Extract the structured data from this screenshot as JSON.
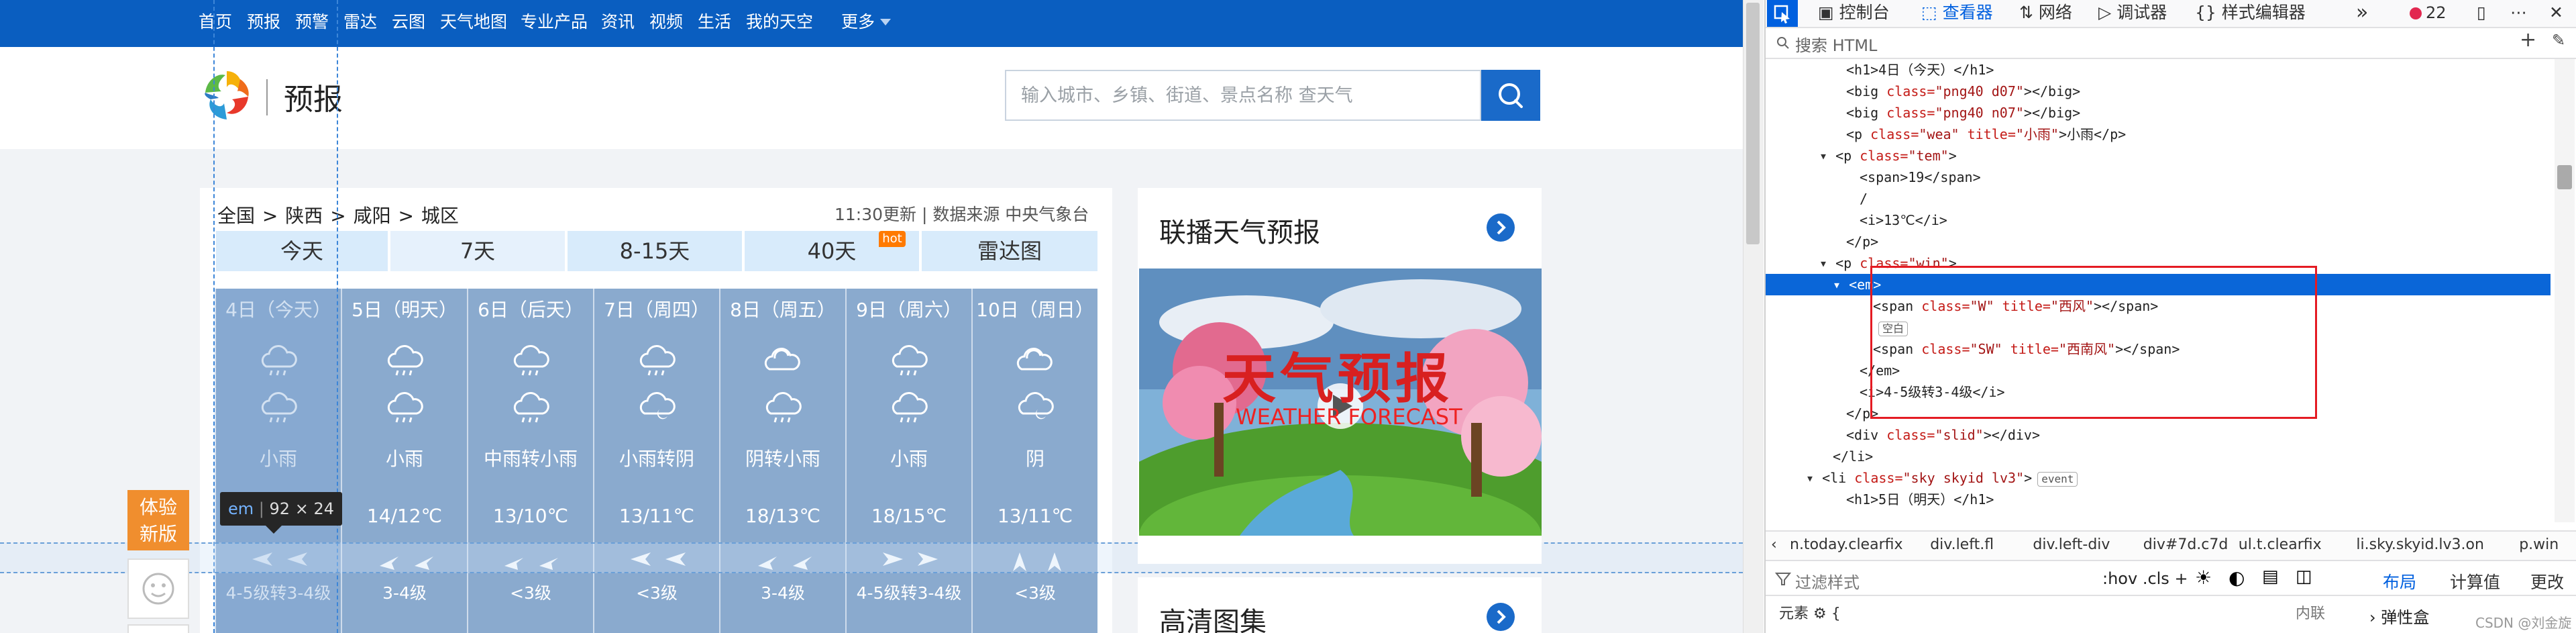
{
  "nav": [
    "首页",
    "预报",
    "预警",
    "雷达",
    "云图",
    "天气地图",
    "专业产品",
    "资讯",
    "视频",
    "生活",
    "我的天空",
    "更多"
  ],
  "header": {
    "logo_text": "预报",
    "search_placeholder": "输入城市、乡镇、街道、景点名称 查天气"
  },
  "breadcrumb": [
    "全国",
    "陕西",
    "咸阳",
    "城区"
  ],
  "update_info": "11:30更新 | 数据来源 中央气象台",
  "tabs": [
    "今天",
    "7天",
    "8-15天",
    "40天",
    "雷达图"
  ],
  "hot_badge": "hot",
  "days": [
    {
      "name": "4日（今天）",
      "weather": "小雨",
      "temp": "",
      "wind": "4-5级转3-4级"
    },
    {
      "name": "5日（明天）",
      "weather": "小雨",
      "temp": "14/12℃",
      "wind": "3-4级"
    },
    {
      "name": "6日（后天）",
      "weather": "中雨转小雨",
      "temp": "13/10℃",
      "wind": "<3级"
    },
    {
      "name": "7日（周四）",
      "weather": "小雨转阴",
      "temp": "13/11℃",
      "wind": "<3级"
    },
    {
      "name": "8日（周五）",
      "weather": "阴转小雨",
      "temp": "18/13℃",
      "wind": "3-4级"
    },
    {
      "name": "9日（周六）",
      "weather": "小雨",
      "temp": "18/15℃",
      "wind": "4-5级转3-4级"
    },
    {
      "name": "10日（周日）",
      "weather": "阴",
      "temp": "13/11℃",
      "wind": "<3级"
    }
  ],
  "tooltip": {
    "tag": "em",
    "dims": "92 × 24"
  },
  "side": {
    "tiyan": "体验\n新版",
    "tiyan_l1": "体验",
    "tiyan_l2": "新版"
  },
  "lianbo": {
    "title": "联播天气预报",
    "video_title": "天气预报",
    "video_sub": "WEATHER FORECAST"
  },
  "gaoqing": {
    "title": "高清图集"
  },
  "devtools": {
    "tabs": [
      "控制台",
      "查看器",
      "网络",
      "调试器",
      "样式编辑器"
    ],
    "active_tab": "查看器",
    "error_count": "22",
    "search_label": "搜索 HTML",
    "tree": [
      {
        "indent": 6,
        "parts": [
          [
            "tx",
            "<h1>4日（今天）</h1>"
          ]
        ]
      },
      {
        "indent": 6,
        "parts": [
          [
            "tx",
            "<big "
          ],
          [
            "at",
            "class="
          ],
          [
            "av",
            "\"png40 d07\""
          ],
          [
            "tx",
            "></big>"
          ]
        ]
      },
      {
        "indent": 6,
        "parts": [
          [
            "tx",
            "<big "
          ],
          [
            "at",
            "class="
          ],
          [
            "av",
            "\"png40 n07\""
          ],
          [
            "tx",
            "></big>"
          ]
        ]
      },
      {
        "indent": 6,
        "parts": [
          [
            "tx",
            "<p "
          ],
          [
            "at",
            "class="
          ],
          [
            "av",
            "\"wea\" "
          ],
          [
            "at",
            "title="
          ],
          [
            "av",
            "\"小雨\""
          ],
          [
            "tx",
            ">小雨</p>"
          ]
        ]
      },
      {
        "indent": 5,
        "twisty": true,
        "parts": [
          [
            "tx",
            "<p "
          ],
          [
            "at",
            "class="
          ],
          [
            "av",
            "\"tem\""
          ],
          [
            "tx",
            ">"
          ]
        ]
      },
      {
        "indent": 7,
        "parts": [
          [
            "tx",
            "<span>19</span>"
          ]
        ]
      },
      {
        "indent": 7,
        "parts": [
          [
            "tx",
            "/"
          ]
        ]
      },
      {
        "indent": 7,
        "parts": [
          [
            "tx",
            "<i>13℃</i>"
          ]
        ]
      },
      {
        "indent": 6,
        "parts": [
          [
            "tx",
            "</p>"
          ]
        ]
      },
      {
        "indent": 5,
        "twisty": true,
        "parts": [
          [
            "tx",
            "<p "
          ],
          [
            "at",
            "class="
          ],
          [
            "av",
            "\"win\""
          ],
          [
            "tx",
            ">"
          ]
        ]
      },
      {
        "indent": 6,
        "twisty": true,
        "sel": true,
        "parts": [
          [
            "tg",
            "<em>"
          ]
        ]
      },
      {
        "indent": 8,
        "parts": [
          [
            "tx",
            "<span "
          ],
          [
            "at",
            "class="
          ],
          [
            "av",
            "\"W\" "
          ],
          [
            "at",
            "title="
          ],
          [
            "av",
            "\"西风\""
          ],
          [
            "tx",
            "></span>"
          ]
        ]
      },
      {
        "indent": 8,
        "badge": "空白",
        "parts": []
      },
      {
        "indent": 8,
        "parts": [
          [
            "tx",
            "<span "
          ],
          [
            "at",
            "class="
          ],
          [
            "av",
            "\"SW\" "
          ],
          [
            "at",
            "title="
          ],
          [
            "av",
            "\"西南风\""
          ],
          [
            "tx",
            "></span>"
          ]
        ]
      },
      {
        "indent": 7,
        "parts": [
          [
            "tx",
            "</em>"
          ]
        ]
      },
      {
        "indent": 7,
        "parts": [
          [
            "tx",
            "<i>4-5级转3-4级</i>"
          ]
        ]
      },
      {
        "indent": 6,
        "parts": [
          [
            "tx",
            "</p>"
          ]
        ]
      },
      {
        "indent": 6,
        "parts": [
          [
            "tx",
            "<div "
          ],
          [
            "at",
            "class="
          ],
          [
            "av",
            "\"slid\""
          ],
          [
            "tx",
            "></div>"
          ]
        ]
      },
      {
        "indent": 5,
        "parts": [
          [
            "tx",
            "</li>"
          ]
        ]
      },
      {
        "indent": 4,
        "twisty": true,
        "event": "event",
        "parts": [
          [
            "tx",
            "<li "
          ],
          [
            "at",
            "class="
          ],
          [
            "av",
            "\"sky skyid lv3\""
          ],
          [
            "tx",
            ">"
          ]
        ]
      },
      {
        "indent": 6,
        "parts": [
          [
            "tx",
            "<h1>5日（明天）</h1>"
          ]
        ]
      }
    ],
    "crumbs": [
      "n.today.clearfix",
      "div.left.fl",
      "div.left-div",
      "div#7d.c7d",
      "ul.t.clearfix",
      "li.sky.skyid.lv3.on",
      "p.win",
      "em"
    ],
    "filter_placeholder": "过滤样式",
    "hov": ":hov  .cls  +",
    "layout_tabs": [
      "布局",
      "计算值",
      "更改"
    ],
    "active_layout": "布局",
    "elem_text": "元素  ⚙ {",
    "inline_text": "内联",
    "flex_text": "› 弹性盒",
    "watermark": "CSDN @刘金旋"
  },
  "colors": {
    "nav_bg": "#0a5ec0",
    "day_bg": "#8aaace",
    "tab_bg": "#d8ebfb",
    "accent": "#1a6ac9",
    "devtools_active": "#0060df",
    "highlight_box": "#e41b23",
    "orange": "#f08e2e"
  }
}
